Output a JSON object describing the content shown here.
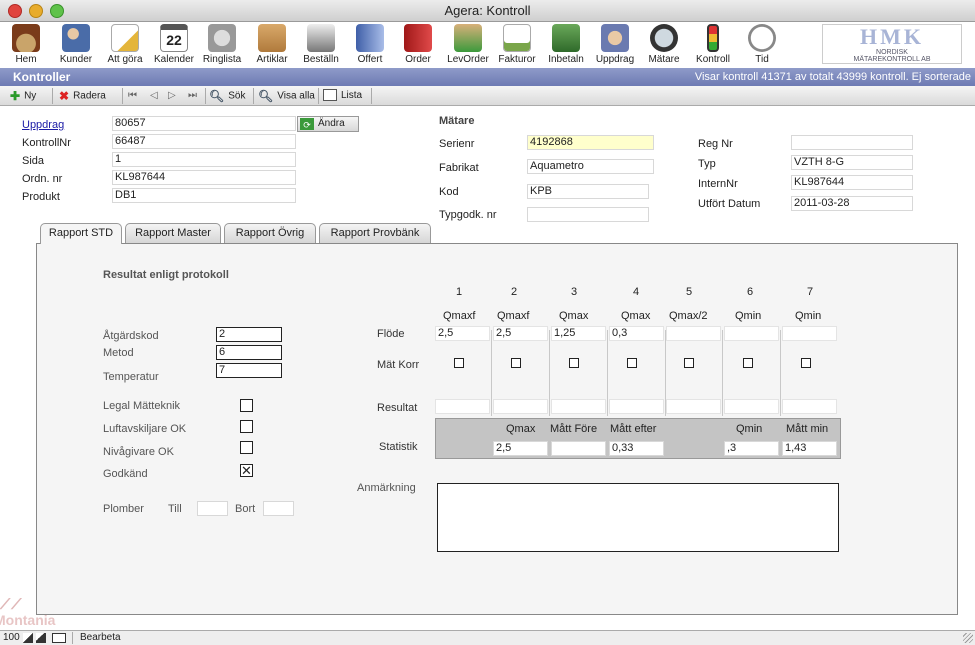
{
  "window": {
    "title": "Agera: Kontroll"
  },
  "toolbar": {
    "items": [
      "Hem",
      "Kunder",
      "Att göra",
      "Kalender",
      "Ringlista",
      "Artiklar",
      "Beställn",
      "Offert",
      "Order",
      "LevOrder",
      "Fakturor",
      "Inbetaln",
      "Uppdrag",
      "Mätare",
      "Kontroll",
      "Tid"
    ],
    "calendar_day": "22"
  },
  "logo": {
    "text": "HMK",
    "sub1": "NORDISK",
    "sub2": "MÄTAREKONTROLL AB"
  },
  "header": {
    "title": "Kontroller",
    "status": "Visar kontroll 41371 av totalt 43999 kontroll. Ej sorterade"
  },
  "actions": {
    "new": "Ny",
    "delete": "Radera",
    "search": "Sök",
    "show_all": "Visa alla",
    "list": "Lista"
  },
  "form": {
    "uppdrag_label": "Uppdrag",
    "uppdrag": "80657",
    "change_button": "Ändra",
    "kontrollnr_label": "KontrollNr",
    "kontrollnr": "66487",
    "sida_label": "Sida",
    "sida": "1",
    "ordnr_label": "Ordn. nr",
    "ordnr": "KL987644",
    "produkt_label": "Produkt",
    "produkt": "DB1"
  },
  "meter": {
    "section": "Mätare",
    "serienr_label": "Serienr",
    "serienr": "4192868",
    "fabrikat_label": "Fabrikat",
    "fabrikat": "Aquametro",
    "kod_label": "Kod",
    "kod": "KPB",
    "typgodk_label": "Typgodk. nr",
    "typgodk": "",
    "regnr_label": "Reg Nr",
    "regnr": "",
    "typ_label": "Typ",
    "typ": "VZTH 8-G",
    "internnr_label": "InternNr",
    "internnr": "KL987644",
    "utfort_label": "Utfört Datum",
    "utfort": "2011-03-28"
  },
  "tabs": [
    "Rapport STD",
    "Rapport Master",
    "Rapport Övrig",
    "Rapport Provbänk"
  ],
  "report": {
    "heading": "Resultat enligt protokoll",
    "atgardskod_label": "Åtgärdskod",
    "atgardskod": "2",
    "metod_label": "Metod",
    "metod": "6",
    "temperatur_label": "Temperatur",
    "temperatur": "7",
    "legal_label": "Legal Mätteknik",
    "legal": false,
    "luft_label": "Luftavskiljare OK",
    "luft": false,
    "niva_label": "Nivågivare OK",
    "niva": false,
    "godkand_label": "Godkänd",
    "godkand": true,
    "plomber_label": "Plomber",
    "till_label": "Till",
    "till": "",
    "bort_label": "Bort",
    "bort": "",
    "columns": [
      "1",
      "2",
      "3",
      "4",
      "5",
      "6",
      "7"
    ],
    "column_types": [
      "Qmaxf",
      "Qmaxf",
      "Qmax",
      "Qmax",
      "Qmax/2",
      "Qmin",
      "Qmin"
    ],
    "flode_label": "Flöde",
    "flode": [
      "2,5",
      "2,5",
      "1,25",
      "0,3",
      "",
      "",
      ""
    ],
    "matkorr_label": "Mät Korr",
    "resultat_label": "Resultat",
    "resultat": [
      "",
      "",
      "",
      "",
      "",
      "",
      ""
    ],
    "statistik_label": "Statistik",
    "stat_headers": [
      "Qmax",
      "Mått Före",
      "Mått efter",
      "Qmin",
      "Mått min"
    ],
    "stat_values": [
      "2,5",
      "",
      "0,33",
      ",3",
      "1,43"
    ],
    "anmarkning_label": "Anmärkning",
    "anmarkning": ""
  },
  "status": {
    "zoom": "100",
    "mode": "Bearbeta",
    "watermark": "Montania"
  },
  "colors": {
    "header_bar": "#7581b9",
    "serienr_highlight": "#ffffcc",
    "link": "#1a1aa6"
  }
}
